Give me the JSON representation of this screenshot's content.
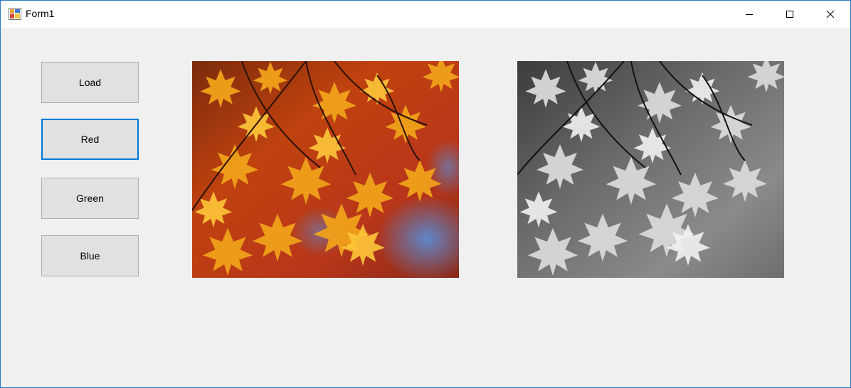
{
  "window": {
    "title": "Form1",
    "controls": {
      "minimize_icon": "minimize-icon",
      "maximize_icon": "maximize-icon",
      "close_icon": "close-icon"
    },
    "accent": "#0078d7"
  },
  "buttons": {
    "load": "Load",
    "red": "Red",
    "green": "Green",
    "blue": "Blue"
  },
  "focused_button": "red",
  "images": {
    "original": {
      "description": "autumn maple leaves, color",
      "icon": "image-original"
    },
    "processed": {
      "description": "autumn maple leaves, grayscale",
      "icon": "image-grayscale"
    }
  }
}
